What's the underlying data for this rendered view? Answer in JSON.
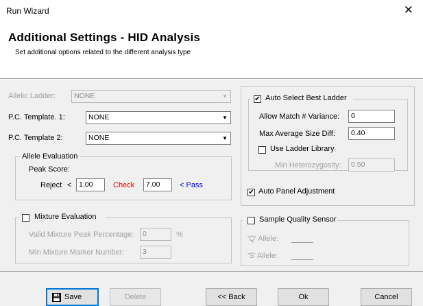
{
  "window": {
    "title": "Run Wizard",
    "close_glyph": "✕"
  },
  "header": {
    "title": "Additional Settings - HID Analysis",
    "subtitle": "Set additional options related to the different analysis type"
  },
  "left": {
    "allelic_ladder": {
      "label": "Allelic Ladder:",
      "value": "NONE"
    },
    "pc_template_1": {
      "label": "P.C. Template. 1:",
      "value": "NONE"
    },
    "pc_template_2": {
      "label": "P.C. Template 2:",
      "value": "NONE"
    },
    "allele_eval": {
      "title": "Allele Evaluation",
      "peak_score_label": "Peak Score:",
      "reject_label": "Reject",
      "lt_symbol": "<",
      "reject_value": "1.00",
      "check_label": "Check",
      "check_value": "7.00",
      "pass_label": "< Pass"
    },
    "mixture": {
      "title": "Mixture Evaluation",
      "checked": false,
      "valid_pct_label": "Valid Mixture Peak Percentage:",
      "valid_pct_value": "0",
      "pct_symbol": "%",
      "min_marker_label": "Min Mixture Marker Number:",
      "min_marker_value": "3"
    }
  },
  "right": {
    "auto_ladder": {
      "title": "Auto Select Best Ladder",
      "checked": true,
      "check_glyph": "✔",
      "variance_label": "Allow Match # Variance:",
      "variance_value": "0",
      "max_size_label": "Max Average Size Diff:",
      "max_size_value": "0.40",
      "use_library_label": "Use Ladder Library",
      "min_het_label": "Min Heterozygosity:",
      "min_het_value": "0.50"
    },
    "auto_panel": {
      "label": "Auto Panel Adjustment",
      "checked": true,
      "check_glyph": "✔"
    },
    "sample_quality": {
      "title": "Sample Quality Sensor",
      "checked": false,
      "q_allele_label": "'Q' Allele:",
      "s_allele_label": "'S' Allele:"
    }
  },
  "buttons": {
    "save": "Save",
    "delete": "Delete",
    "back": "<< Back",
    "ok": "Ok",
    "cancel": "Cancel"
  },
  "icons": {
    "save": "floppy-disk-icon",
    "dropdown": "chevron-down-icon"
  },
  "colors": {
    "check": "#e00000",
    "pass": "#0000e0",
    "default_button": "#0078d7"
  }
}
